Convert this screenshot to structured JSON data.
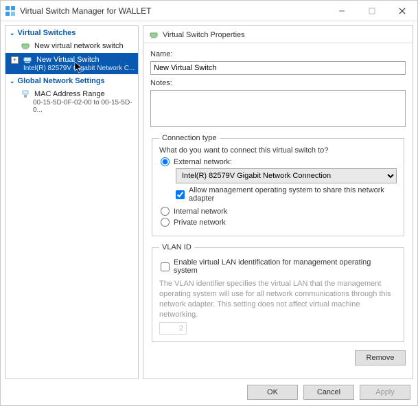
{
  "window": {
    "title": "Virtual Switch Manager for WALLET"
  },
  "tree": {
    "section1": "Virtual Switches",
    "new_switch": "New virtual network switch",
    "sel_label": "New Virtual Switch",
    "sel_sub": "Intel(R) 82579V Gigabit Network C...",
    "section2": "Global Network Settings",
    "mac_label": "MAC Address Range",
    "mac_sub": "00-15-5D-0F-02-00 to 00-15-5D-0..."
  },
  "props": {
    "header": "Virtual Switch Properties",
    "name_label": "Name:",
    "name_value": "New Virtual Switch",
    "notes_label": "Notes:"
  },
  "conn": {
    "legend": "Connection type",
    "hint": "What do you want to connect this virtual switch to?",
    "external": "External network:",
    "adapter": "Intel(R) 82579V Gigabit Network Connection",
    "allow_mgmt": "Allow management operating system to share this network adapter",
    "internal": "Internal network",
    "private": "Private network"
  },
  "vlan": {
    "legend": "VLAN ID",
    "enable": "Enable virtual LAN identification for management operating system",
    "help": "The VLAN identifier specifies the virtual LAN that the management operating system will use for all network communications through this network adapter. This setting does not affect virtual machine networking.",
    "value": "2"
  },
  "buttons": {
    "remove": "Remove",
    "ok": "OK",
    "cancel": "Cancel",
    "apply": "Apply"
  }
}
